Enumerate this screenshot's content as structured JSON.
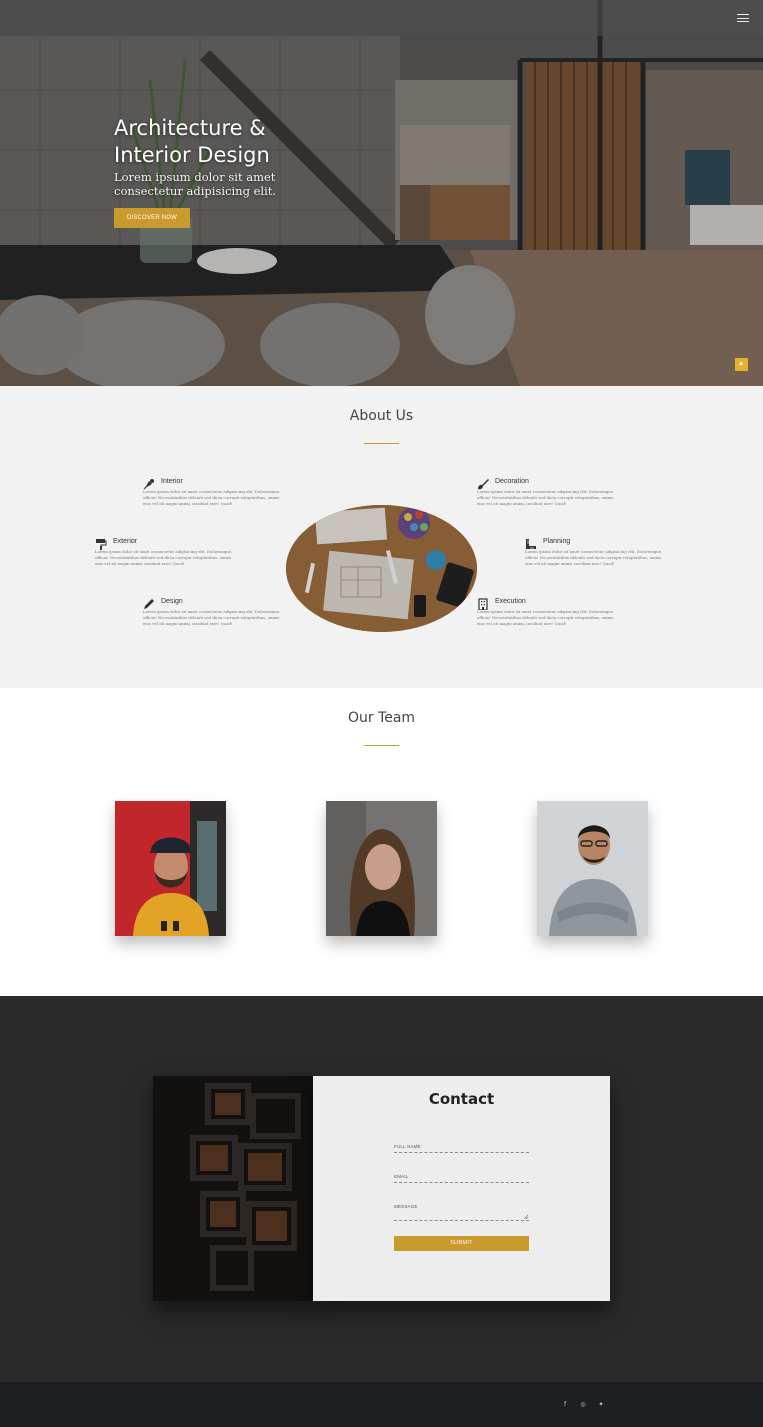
{
  "hero": {
    "title_line1": "Architecture &",
    "title_line2": "Interior Design",
    "subtitle": "Lorem ipsum dolor sit amet consectetur adipisicing elit.",
    "button": "DISCOVER NOW",
    "menu_icon": "hamburger-icon",
    "scroll_top_icon": "arrow-up-icon",
    "accent": "#c99a2e"
  },
  "about": {
    "title": "About Us",
    "services": [
      {
        "name": "Interior",
        "icon": "pen-nib-icon",
        "text": "Lorem ipsum dolor sit amet consectetur adipisicing elit. Doloremque, officia! Necessitatibus deleniti sed dicta corrupti voluptatibus, omnis eius vel ab magni animi, incidunt iure! Quod!"
      },
      {
        "name": "Decoration",
        "icon": "paint-brush-icon",
        "text": "Lorem ipsum dolor sit amet consectetur adipisicing elit. Doloremque, officia! Necessitatibus deleniti sed dicta corrupti voluptatibus, omnis eius vel ab magni animi, incidunt iure! Quod!"
      },
      {
        "name": "Exterior",
        "icon": "paint-roller-icon",
        "text": "Lorem ipsum dolor sit amet consectetur adipisicing elit. Doloremque, officia! Necessitatibus deleniti sed dicta corrupti voluptatibus, omnis eius vel ab magni animi, incidunt iure! Quod!"
      },
      {
        "name": "Planning",
        "icon": "ruler-combined-icon",
        "text": "Lorem ipsum dolor sit amet consectetur adipisicing elit. Doloremque, officia! Necessitatibus deleniti sed dicta corrupti voluptatibus, omnis eius vel ab magni animi, incidunt iure! Quod!"
      },
      {
        "name": "Design",
        "icon": "pencil-icon",
        "text": "Lorem ipsum dolor sit amet consectetur adipisicing elit. Doloremque, officia! Necessitatibus deleniti sed dicta corrupti voluptatibus, omnis eius vel ab magni animi, incidunt iure! Quod!"
      },
      {
        "name": "Execution",
        "icon": "building-icon",
        "text": "Lorem ipsum dolor sit amet consectetur adipisicing elit. Doloremque, officia! Necessitatibus deleniti sed dicta corrupti voluptatibus, omnis eius vel ab magni animi, incidunt iure! Quod!"
      }
    ]
  },
  "team": {
    "title": "Our Team"
  },
  "contact": {
    "title": "Contact",
    "full_name_label": "FULL NAME",
    "email_label": "EMAIL",
    "message_label": "MESSAGE",
    "submit": "SUBMIT"
  },
  "footer": {
    "social": [
      {
        "icon": "facebook-icon",
        "glyph": "f"
      },
      {
        "icon": "instagram-icon",
        "glyph": "◎"
      },
      {
        "icon": "twitter-icon",
        "glyph": "✦"
      }
    ]
  }
}
